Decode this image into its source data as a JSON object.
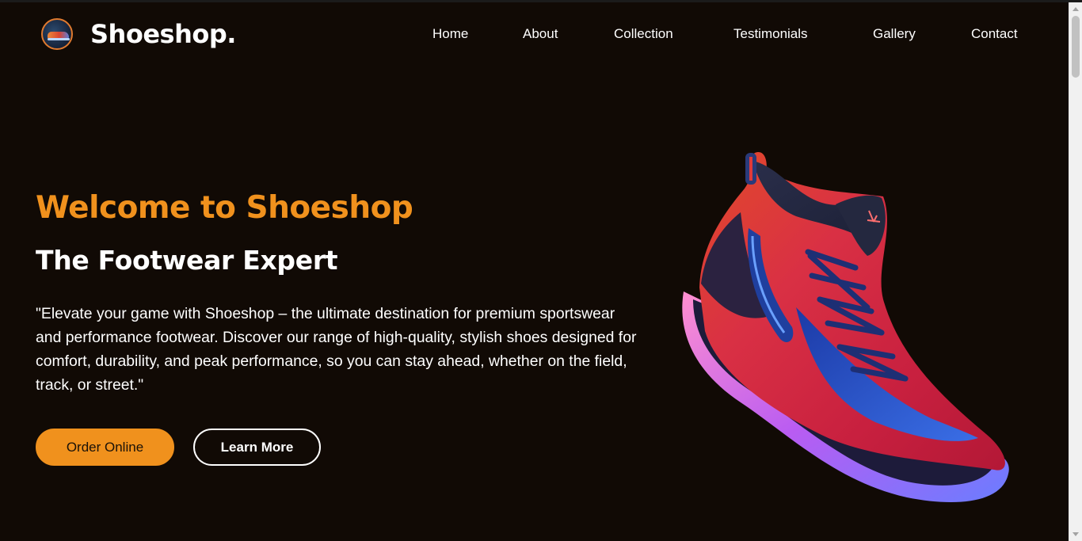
{
  "header": {
    "brand": "Shoeshop.",
    "logo_icon": "shoe-logo-icon"
  },
  "nav": {
    "items": [
      {
        "label": "Home"
      },
      {
        "label": "About"
      },
      {
        "label": "Collection"
      },
      {
        "label": "Testimonials"
      },
      {
        "label": "Gallery"
      },
      {
        "label": "Contact"
      }
    ]
  },
  "hero": {
    "title": "Welcome to Shoeshop",
    "subtitle": "The Footwear Expert",
    "description": "\"Elevate your game with Shoeshop – the ultimate destination for premium sportswear and performance footwear. Discover our range of high-quality, stylish shoes designed for comfort, durability, and peak performance, so you can stay ahead, whether on the field, track, or street.\"",
    "order_label": "Order Online",
    "learn_label": "Learn More",
    "image_icon": "sneaker-image"
  },
  "colors": {
    "background": "#110a05",
    "accent": "#f0911d",
    "text": "#ffffff"
  }
}
